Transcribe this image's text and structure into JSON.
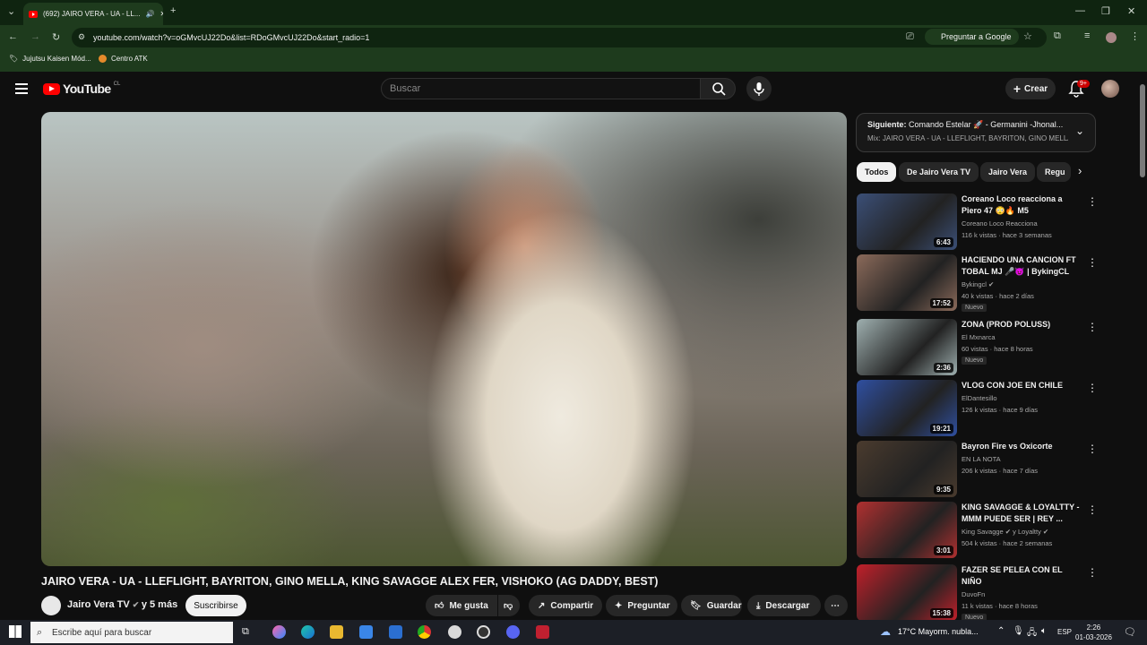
{
  "browser": {
    "tab_title": "(692) JAIRO VERA - UA - LL...",
    "url": "youtube.com/watch?v=oGMvcUJ22Do&list=RDoGMvcUJ22Do&start_radio=1",
    "ask_google": "Preguntar a Google",
    "bookmarks": [
      "Jujutsu Kaisen Mód...",
      "Centro ATK"
    ]
  },
  "youtube": {
    "logo_text": "YouTube",
    "logo_region": "CL",
    "search_placeholder": "Buscar",
    "create_label": "Crear",
    "notification_count": "9+"
  },
  "video": {
    "title": "JAIRO VERA - UA - LLEFLIGHT, BAYRITON, GINO MELLA, KING SAVAGGE ALEX FER, VISHOKO (AG DADDY, BEST)",
    "channel": "Jairo Vera TV",
    "channel_extra": "y 5 más",
    "subscribe_label": "Suscribirse",
    "actions": {
      "like": "Me gusta",
      "share": "Compartir",
      "ask": "Preguntar",
      "save": "Guardar",
      "download": "Descargar"
    }
  },
  "up_next": {
    "prefix": "Siguiente:",
    "title": "Comando Estelar 🚀 - Germanini -Jhonal...",
    "mix": "Mix: JAIRO VERA - UA - LLEFLIGHT, BAYRITON, GINO MELLA..."
  },
  "chips": [
    "Todos",
    "De Jairo Vera TV",
    "Jairo Vera",
    "Regu"
  ],
  "recommendations": [
    {
      "title": "Coreano Loco reacciona a Piero 47 😳🔥 M5",
      "channel": "Coreano Loco Reacciona",
      "meta": "116 k vistas · hace 3 semanas",
      "duration": "6:43",
      "badge": ""
    },
    {
      "title": "HACIENDO UNA CANCION FT TOBAL MJ 🎤😈 | BykingCL",
      "channel": "Bykingcl ✔",
      "meta": "40 k vistas · hace 2 días",
      "duration": "17:52",
      "badge": "Nuevo"
    },
    {
      "title": "ZONA (PROD POLUSS)",
      "channel": "El Mxnarca",
      "meta": "60 vistas · hace 8 horas",
      "duration": "2:36",
      "badge": "Nuevo"
    },
    {
      "title": "VLOG CON JOE EN CHILE",
      "channel": "ElDantesillo",
      "meta": "126 k vistas · hace 9 días",
      "duration": "19:21",
      "badge": ""
    },
    {
      "title": "Bayron Fire vs Oxicorte",
      "channel": "EN LA NOTA",
      "meta": "206 k vistas · hace 7 días",
      "duration": "9:35",
      "badge": ""
    },
    {
      "title": "KING SAVAGGE & LOYALTTY - MMM PUEDE SER | REY ...",
      "channel": "King Savagge ✔ y Loyaltty ✔",
      "meta": "504 k vistas · hace 2 semanas",
      "duration": "3:01",
      "badge": ""
    },
    {
      "title": "FAZER SE PELEA CON EL NIÑO",
      "channel": "DuvoFn",
      "meta": "11 k vistas · hace 8 horas",
      "duration": "15:38",
      "badge": "Nuevo"
    }
  ],
  "thumb_colors": [
    "#3b4f77",
    "#8b6a5a",
    "#9fb0b0",
    "#2f4fa0",
    "#4a3b2e",
    "#b03030",
    "#c0202a"
  ],
  "taskbar": {
    "search_placeholder": "Escribe aquí para buscar",
    "weather": "17°C  Mayorm. nubla...",
    "lang": "ESP",
    "time": "2:26",
    "date": "01-03-2026"
  }
}
